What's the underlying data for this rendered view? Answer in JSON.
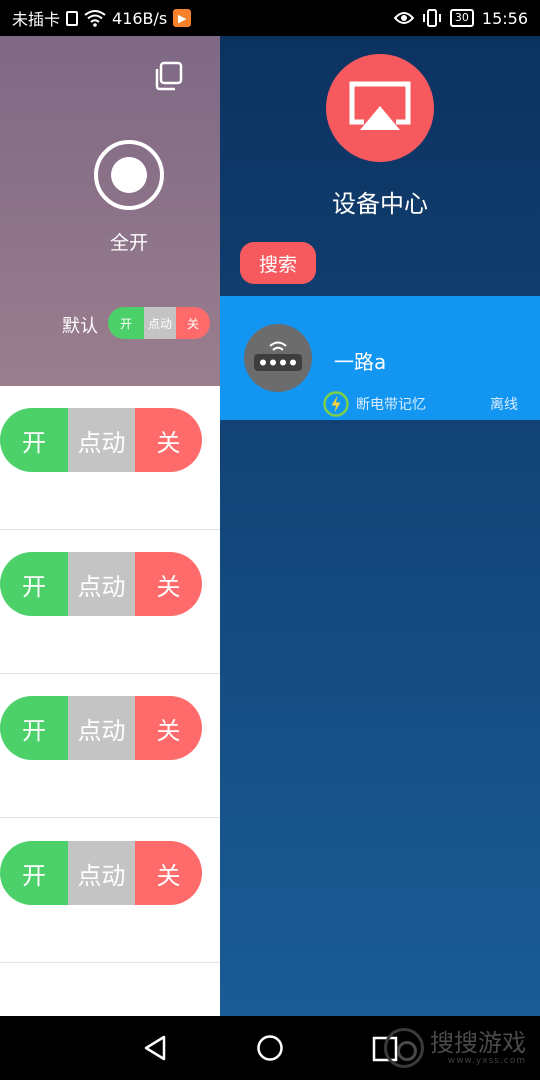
{
  "status_bar": {
    "carrier": "未插卡",
    "speed": "416B/s",
    "battery": "30",
    "time": "15:56"
  },
  "left_panel": {
    "all_on_label": "全开",
    "default_label": "默认",
    "mini_switch": {
      "on": "开",
      "mid": "点动",
      "off": "关"
    },
    "channels": [
      {
        "on": "开",
        "mid": "点动",
        "off": "关"
      },
      {
        "on": "开",
        "mid": "点动",
        "off": "关"
      },
      {
        "on": "开",
        "mid": "点动",
        "off": "关"
      },
      {
        "on": "开",
        "mid": "点动",
        "off": "关"
      }
    ]
  },
  "right_panel": {
    "title": "设备中心",
    "search_button": "搜索",
    "device": {
      "name": "一路a",
      "memory_label": "断电带记忆",
      "status": "离线"
    }
  },
  "watermark": {
    "text": "搜搜游戏",
    "sub": "www.yxss.com"
  },
  "colors": {
    "on_green": "#4cd16a",
    "mid_gray": "#c4c4c4",
    "off_red": "#ff6b6b",
    "accent_red": "#f65a5e",
    "device_card_blue": "#1396f2"
  },
  "icons": [
    "copy-icon",
    "power-icon",
    "airplay-icon",
    "router-icon",
    "bolt-icon",
    "back-icon",
    "home-icon",
    "recents-icon"
  ]
}
